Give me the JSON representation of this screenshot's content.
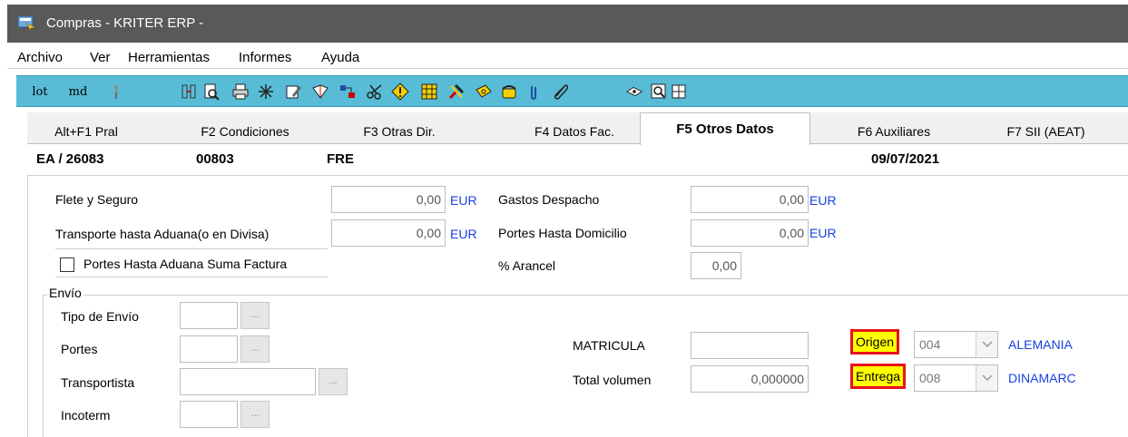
{
  "window": {
    "title": "Compras - KRITER ERP -"
  },
  "menu": [
    "Archivo",
    "Ver",
    "Herramientas",
    "Informes",
    "Ayuda"
  ],
  "toolbar": {
    "text_items": [
      "lot",
      "md"
    ],
    "icons": [
      "pin-icon",
      "split-icon",
      "print-preview-icon",
      "print-icon",
      "asterisk-icon",
      "edit-doc-icon",
      "book-icon",
      "transfer-icon",
      "scissors-icon",
      "warning-diamond-icon",
      "grid-app-icon",
      "tools-icon",
      "money-icon",
      "phone-icon",
      "clip-icon",
      "paperclip-icon",
      "glasses-icon",
      "zoom-doc-icon",
      "table-icon"
    ],
    "colors": {
      "background": "#58bcd6"
    }
  },
  "tabs": [
    {
      "label": "Alt+F1 Pral"
    },
    {
      "label": "F2 Condiciones"
    },
    {
      "label": "F3 Otras Dir."
    },
    {
      "label": "F4 Datos Fac."
    },
    {
      "label": "F5 Otros Datos"
    },
    {
      "label": "F6 Auxiliares"
    },
    {
      "label": "F7 SII (AEAT)"
    }
  ],
  "header": {
    "doc_id": "EA / 26083",
    "code": "00803",
    "ref": "FRE",
    "date": "09/07/2021"
  },
  "costs": {
    "flete_label": "Flete y Seguro",
    "flete_value": "0,00",
    "transporte_label": "Transporte hasta Aduana(o en Divisa)",
    "transporte_value": "0,00",
    "currency": "EUR",
    "gastos_label": "Gastos Despacho",
    "gastos_value": "0,00",
    "portes_domicilio_label": "Portes Hasta Domicilio",
    "portes_domicilio_value": "0,00",
    "portes_aduana_checkbox_label": "Portes Hasta Aduana Suma Factura",
    "arancel_label": "% Arancel",
    "arancel_value": "0,00"
  },
  "envio": {
    "group_label": "Envío",
    "tipo_label": "Tipo de Envío",
    "portes_label": "Portes",
    "transportista_label": "Transportista",
    "incoterm_label": "Incoterm",
    "lookup_button": "...",
    "matricula_label": "MATRICULA",
    "matricula_value": "",
    "volumen_label": "Total volumen",
    "volumen_value": "0,000000",
    "origen_label": "Origen",
    "origen_code": "004",
    "origen_country": "ALEMANIA",
    "entrega_label": "Entrega",
    "entrega_code": "008",
    "entrega_country": "DINAMARC"
  }
}
